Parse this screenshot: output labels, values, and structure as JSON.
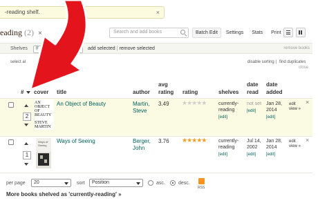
{
  "notice": {
    "text": "-reading shelf.",
    "close": "×"
  },
  "header": {
    "title": "eading",
    "count": "(2)",
    "close": "×"
  },
  "search": {
    "placeholder": "Search and add books"
  },
  "toolbar": {
    "batch_edit": "Batch Edit",
    "settings": "Settings",
    "stats": "Stats",
    "print": "Print"
  },
  "shelf_bar": {
    "label": "Shelves",
    "selected": "(r",
    "add_selected": "add selected",
    "separator": "|",
    "remove_selected": "remove selected",
    "remove_books": "remove books"
  },
  "sub_bar": {
    "select_all": "select al",
    "disable_sorting": "disable sorting",
    "separator": "|",
    "find_duplicates": "find duplicates",
    "close": "close"
  },
  "table": {
    "headers": {
      "num": "#",
      "cover": "cover",
      "title": "title",
      "author": "author",
      "avg_rating": [
        "avg",
        "rating"
      ],
      "rating": "rating",
      "shelves": "shelves",
      "date_read": [
        "date",
        "read"
      ],
      "date_added": [
        "date",
        "added"
      ]
    },
    "rows": [
      {
        "position": "2",
        "cover_text": [
          "AN",
          "OBJECT",
          "OF",
          "BEAUTY",
          "STEVE",
          "MARTIN"
        ],
        "title": "An Object of Beauty",
        "author": [
          "Martin,",
          "Steve"
        ],
        "avg_rating": "3.49",
        "rating_stars": "★★★★★",
        "rating_value": 0,
        "shelves": [
          "currently-",
          "reading"
        ],
        "shelves_edit": "[edit]",
        "date_read": "not set",
        "date_read_edit": "[edit]",
        "date_added": [
          "Jan 28,",
          "2014"
        ],
        "date_added_edit": "[edit]",
        "actions": [
          "edit",
          "view »"
        ],
        "remove": "×"
      },
      {
        "position": "1",
        "cover_text": [
          "Ways of",
          "Seeing"
        ],
        "title": "Ways of Seeing",
        "author": [
          "Berger,",
          "John"
        ],
        "avg_rating": "3.76",
        "rating_stars": "★★★★★",
        "rating_value": 5,
        "shelves": [
          "currently-",
          "reading"
        ],
        "shelves_edit": "[edit]",
        "date_read": [
          "Jul 14,",
          "2002"
        ],
        "date_read_edit": "[edit]",
        "date_added": [
          "Jan 28,",
          "2014"
        ],
        "date_added_edit": "[edit]",
        "actions": [
          "edit",
          "view »"
        ],
        "remove": "×"
      }
    ]
  },
  "footer": {
    "per_page_label": "per page",
    "per_page_value": "20",
    "sort_label": "sort",
    "sort_value": "Position",
    "asc": "asc.",
    "desc": "desc.",
    "rss": "RSS",
    "more_link": "More books shelved as 'currently-reading' »"
  },
  "colors": {
    "highlight_row": "#fbfae3",
    "link": "#00635d",
    "star": "#f59c1e",
    "annotation_arrow": "#e3141b"
  }
}
